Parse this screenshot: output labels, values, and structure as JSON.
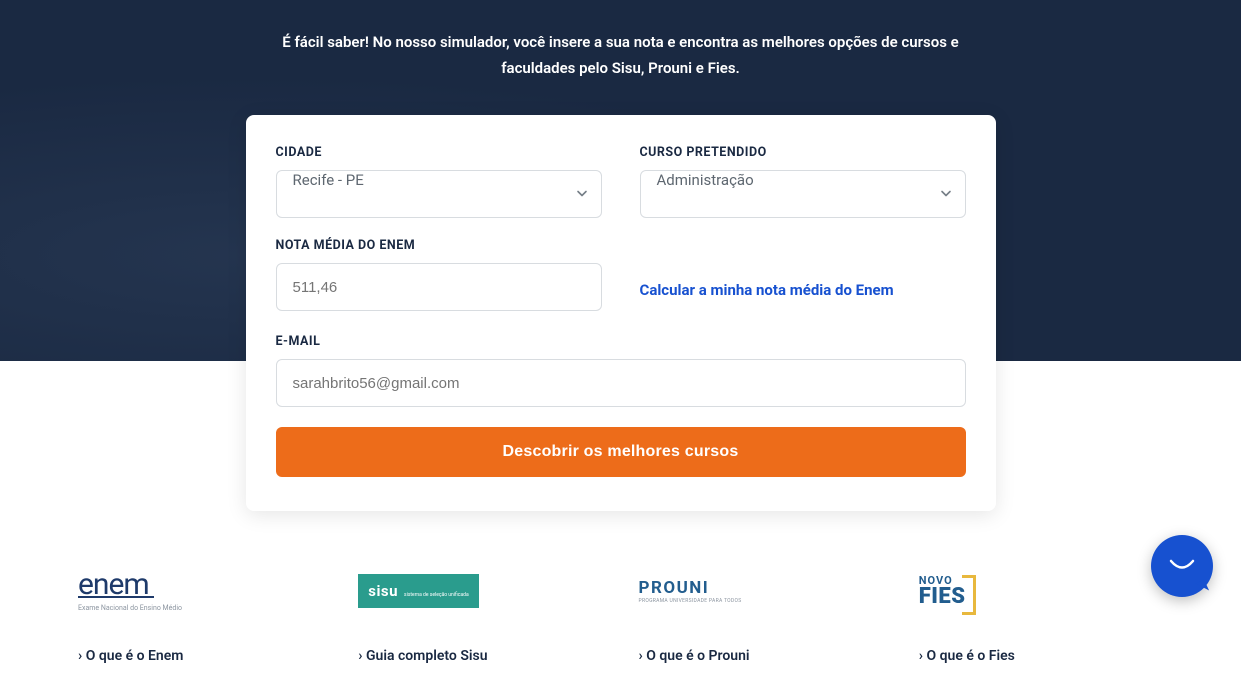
{
  "hero": {
    "intro": "É fácil saber! No nosso simulador, você insere a sua nota e encontra as melhores opções de cursos e faculdades pelo Sisu, Prouni e Fies."
  },
  "form": {
    "cidade": {
      "label": "CIDADE",
      "value": "Recife - PE"
    },
    "curso": {
      "label": "CURSO PRETENDIDO",
      "value": "Administração"
    },
    "nota": {
      "label": "NOTA MÉDIA DO ENEM",
      "placeholder": "511,46"
    },
    "calc_link": "Calcular a minha nota média do Enem",
    "email": {
      "label": "E-MAIL",
      "placeholder": "sarahbrito56@gmail.com"
    },
    "submit": "Descobrir os melhores cursos"
  },
  "programs": {
    "enem": {
      "logo_main": "enem",
      "logo_sub": "Exame Nacional\ndo Ensino Médio",
      "link1": "O que é o Enem"
    },
    "sisu": {
      "logo_main": "sisu",
      "logo_sub": "sistema de\nseleção\nunificada",
      "link1": "Guia completo Sisu"
    },
    "prouni": {
      "logo_main": "PROUNI",
      "logo_sub": "PROGRAMA UNIVERSIDADE PARA TODOS",
      "link1": "O que é o Prouni"
    },
    "fies": {
      "logo_novo": "NOVO",
      "logo_main": "FIES",
      "link1": "O que é o Fies"
    }
  }
}
